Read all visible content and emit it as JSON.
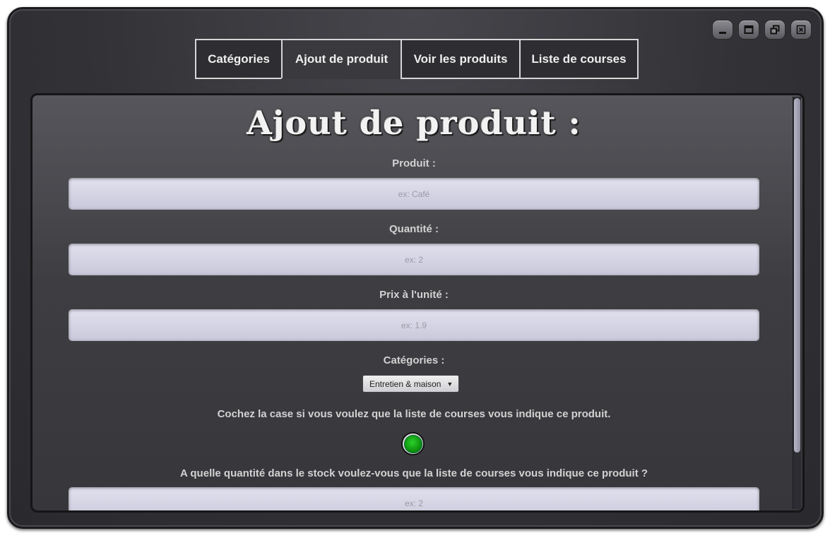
{
  "window": {
    "controls": [
      {
        "name": "minimize-icon"
      },
      {
        "name": "maximize-icon"
      },
      {
        "name": "restore-icon"
      },
      {
        "name": "close-icon"
      }
    ]
  },
  "tabs": [
    {
      "label": "Catégories"
    },
    {
      "label": "Ajout de produit",
      "active": true
    },
    {
      "label": "Voir les produits"
    },
    {
      "label": "Liste de courses"
    }
  ],
  "form": {
    "title": "Ajout de produit :",
    "product": {
      "label": "Produit :",
      "placeholder": "ex: Café",
      "value": ""
    },
    "quantity": {
      "label": "Quantité :",
      "placeholder": "ex: 2",
      "value": ""
    },
    "price": {
      "label": "Prix à l'unité :",
      "placeholder": "ex: 1.9",
      "value": ""
    },
    "category": {
      "label": "Catégories :",
      "selected": "Entretien & maison"
    },
    "track": {
      "label": "Cochez la case si vous voulez que la liste de courses vous indique ce produit.",
      "checked": true
    },
    "threshold": {
      "label": "A quelle quantité dans le stock voulez-vous que la liste de courses vous indique ce produit ?",
      "placeholder": "ex: 2",
      "value": ""
    }
  },
  "colors": {
    "accent_green": "#1aa01a",
    "field_bg": "#d4d4e4",
    "panel_bg": "#3e3e42"
  }
}
